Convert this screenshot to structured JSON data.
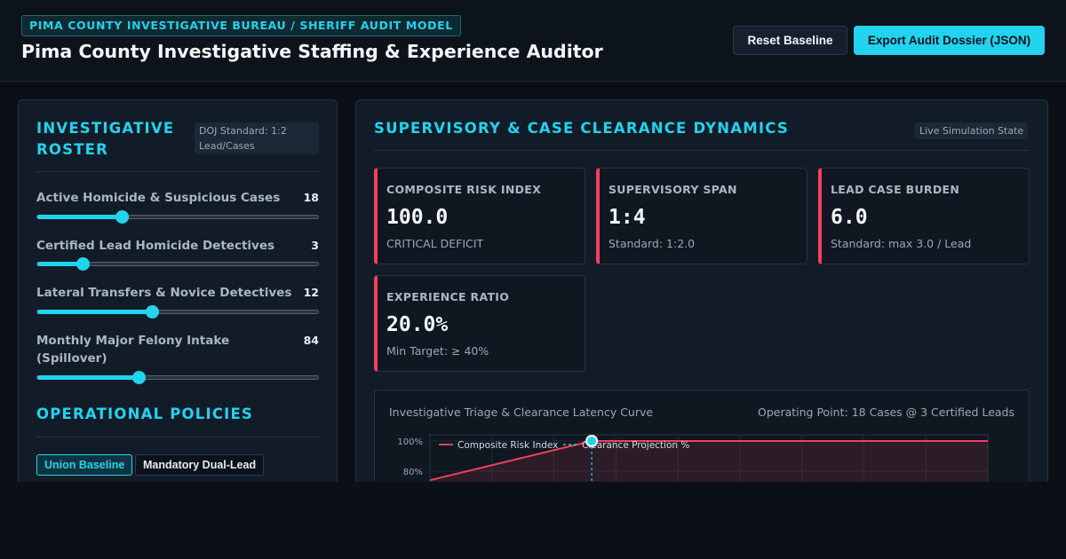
{
  "header": {
    "badge": "PIMA COUNTY INVESTIGATIVE BUREAU / SHERIFF AUDIT MODEL",
    "title": "Pima County Investigative Staffing & Experience Auditor",
    "reset_label": "Reset Baseline",
    "export_label": "Export Audit Dossier (JSON)"
  },
  "roster": {
    "title": "INVESTIGATIVE ROSTER",
    "standard_chip": "DOJ Standard: 1:2 Lead/Cases",
    "sliders": [
      {
        "label": "Active Homicide & Suspicious Cases",
        "value": "18",
        "fraction": 0.3
      },
      {
        "label": "Certified Lead Homicide Detectives",
        "value": "3",
        "fraction": 0.16
      },
      {
        "label": "Lateral Transfers & Novice Detectives",
        "value": "12",
        "fraction": 0.405
      },
      {
        "label": "Monthly Major Felony Intake (Spillover)",
        "value": "84",
        "fraction": 0.36
      }
    ]
  },
  "policies": {
    "title": "OPERATIONAL POLICIES",
    "buttons": [
      "Union Baseline",
      "Mandatory Dual-Lead"
    ],
    "active": "Union Baseline"
  },
  "dynamics": {
    "title": "SUPERVISORY & CASE CLEARANCE DYNAMICS",
    "state_chip": "Live Simulation State",
    "metrics": [
      {
        "label": "COMPOSITE RISK INDEX",
        "value": "100.0",
        "sub": "CRITICAL DEFICIT"
      },
      {
        "label": "SUPERVISORY SPAN",
        "value": "1:4",
        "sub": "Standard: 1:2.0"
      },
      {
        "label": "LEAD CASE BURDEN",
        "value": "6.0",
        "sub": "Standard: max 3.0 / Lead"
      },
      {
        "label": "EXPERIENCE RATIO",
        "value": "20.0%",
        "sub": "Min Target: ≥ 40%"
      }
    ],
    "accent_color": "#f43f5e"
  },
  "chart": {
    "title": "Investigative Triage & Clearance Latency Curve",
    "operating_point": "Operating Point: 18 Cases @ 3 Certified Leads"
  },
  "chart_data": {
    "type": "line",
    "y_ticks": [
      "100%",
      "80%"
    ],
    "ylim": [
      0,
      100
    ],
    "series": [
      {
        "name": "Composite Risk Index",
        "color": "#f43f5e",
        "x": [
          0,
          0.29,
          1.0
        ],
        "values": [
          74,
          100,
          100
        ]
      },
      {
        "name": "Clearance Projection %",
        "color": "#22d3ee",
        "dashed": true
      }
    ],
    "operating_point_value": 100
  }
}
